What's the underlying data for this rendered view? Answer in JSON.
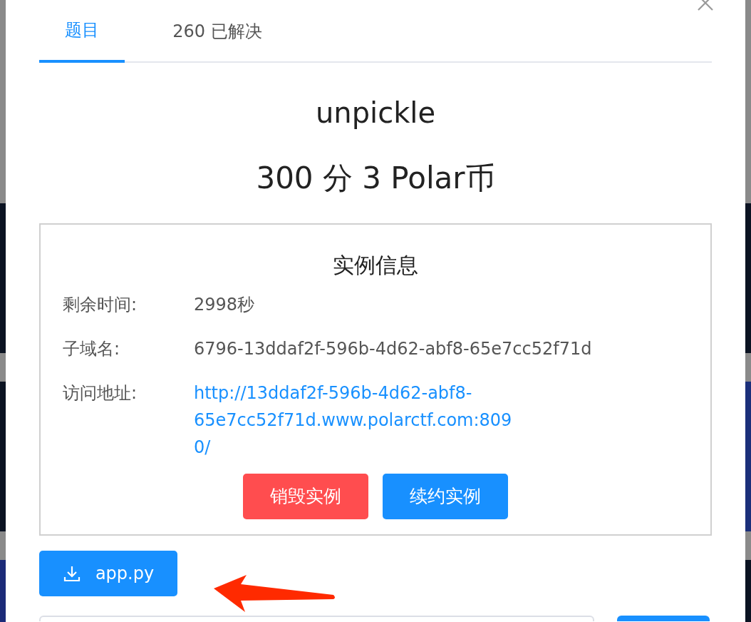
{
  "tabs": [
    {
      "label": "题目",
      "selected": true
    },
    {
      "label": "260 已解决",
      "selected": false
    }
  ],
  "challenge": {
    "title": "unpickle",
    "reward": "300 分 3 Polar币"
  },
  "instance": {
    "heading": "实例信息",
    "fields": [
      {
        "kind": "text",
        "label": "剩余时间:",
        "value": "2998秒"
      },
      {
        "kind": "text",
        "label": "子域名:",
        "value": "6796-13ddaf2f-596b-4d62-abf8-65e7cc52f71d"
      },
      {
        "kind": "link",
        "label": "访问地址:",
        "value": "http://13ddaf2f-596b-4d62-abf8-65e7cc52f71d.www.polarctf.com:8090/"
      }
    ],
    "buttons": [
      {
        "kind": "danger",
        "label": "销毁实例"
      },
      {
        "kind": "primary",
        "label": "续约实例"
      }
    ]
  },
  "attachment": {
    "label": "app.py"
  }
}
